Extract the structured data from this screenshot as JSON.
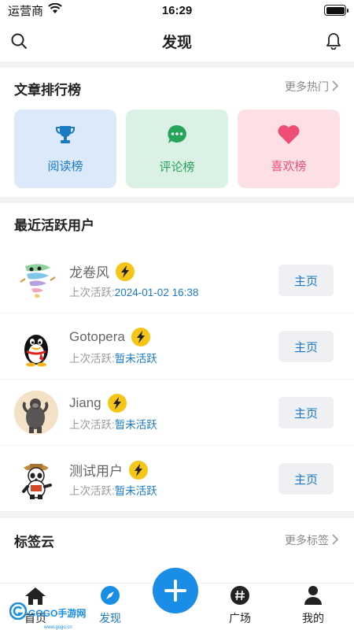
{
  "status_bar": {
    "carrier": "运营商",
    "time": "16:29"
  },
  "nav": {
    "title": "发现"
  },
  "article_rank": {
    "title": "文章排行榜",
    "more": "更多热门",
    "tiles": [
      {
        "label": "阅读榜",
        "icon": "trophy-icon",
        "bg": "#dbe9fb",
        "color": "#1a7ac4"
      },
      {
        "label": "评论榜",
        "icon": "chat-bubble-icon",
        "bg": "#dcf1e5",
        "color": "#25a45a"
      },
      {
        "label": "喜欢榜",
        "icon": "heart-icon",
        "bg": "#fce0e6",
        "color": "#ee4d76"
      }
    ]
  },
  "active_users": {
    "title": "最近活跃用户",
    "last_active_label": "上次活跃:",
    "home_button_label": "主页",
    "users": [
      {
        "name": "龙卷风",
        "last_active": "2024-01-02 16:38",
        "avatar": "tornado-avatar"
      },
      {
        "name": "Gotopera",
        "last_active": "暂未活跃",
        "avatar": "penguin-avatar"
      },
      {
        "name": "Jiang",
        "last_active": "暂未活跃",
        "avatar": "gorilla-avatar"
      },
      {
        "name": "测试用户",
        "last_active": "暂未活跃",
        "avatar": "panda-avatar"
      }
    ]
  },
  "tag_cloud": {
    "title": "标签云",
    "more": "更多标签"
  },
  "tab_bar": {
    "tabs": [
      {
        "label": "首页",
        "icon": "home-icon"
      },
      {
        "label": "发现",
        "icon": "compass-icon",
        "active": true
      },
      {
        "label": "",
        "icon": "plus-icon"
      },
      {
        "label": "广场",
        "icon": "hashtag-icon"
      },
      {
        "label": "我的",
        "icon": "user-icon"
      }
    ]
  },
  "watermark": {
    "logo": "GO",
    "text": "GOGO手游网",
    "sub": "www.gogo.cn"
  },
  "colors": {
    "accent": "#1a8ee6",
    "link": "#1a7ac4",
    "bolt": "#f5c518"
  }
}
